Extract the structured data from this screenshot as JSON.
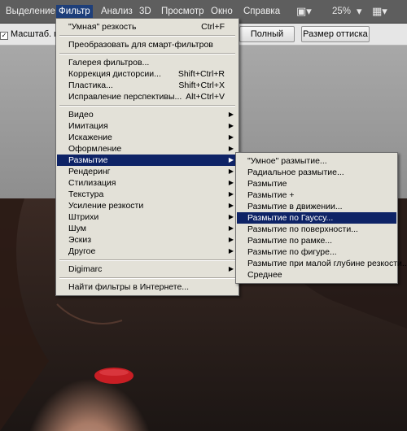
{
  "menubar": {
    "items": [
      "Выделение",
      "Фильтр",
      "Анализ",
      "3D",
      "Просмотр",
      "Окно",
      "Справка"
    ],
    "active": "Фильтр",
    "zoom": "25%"
  },
  "options_bar": {
    "checkbox_label": "Масштаб. пере",
    "buttons": [
      "Полный экран",
      "Размер оттиска"
    ]
  },
  "filter_menu": {
    "items": [
      {
        "label": "\"Умная\" резкость",
        "shortcut": "Ctrl+F"
      },
      {
        "label": "Преобразовать для смарт-фильтров"
      },
      {
        "label": "Галерея фильтров..."
      },
      {
        "label": "Коррекция дисторсии...",
        "shortcut": "Shift+Ctrl+R"
      },
      {
        "label": "Пластика...",
        "shortcut": "Shift+Ctrl+X"
      },
      {
        "label": "Исправление перспективы...",
        "shortcut": "Alt+Ctrl+V"
      },
      {
        "label": "Видео",
        "submenu": true
      },
      {
        "label": "Имитация",
        "submenu": true
      },
      {
        "label": "Искажение",
        "submenu": true
      },
      {
        "label": "Оформление",
        "submenu": true
      },
      {
        "label": "Размытие",
        "submenu": true,
        "highlighted": true
      },
      {
        "label": "Рендеринг",
        "submenu": true
      },
      {
        "label": "Стилизация",
        "submenu": true
      },
      {
        "label": "Текстура",
        "submenu": true
      },
      {
        "label": "Усиление резкости",
        "submenu": true
      },
      {
        "label": "Штрихи",
        "submenu": true
      },
      {
        "label": "Шум",
        "submenu": true
      },
      {
        "label": "Эскиз",
        "submenu": true
      },
      {
        "label": "Другое",
        "submenu": true
      },
      {
        "label": "Digimarc",
        "submenu": true
      },
      {
        "label": "Найти фильтры в Интернете..."
      }
    ]
  },
  "blur_submenu": {
    "items": [
      {
        "label": "\"Умное\" размытие..."
      },
      {
        "label": "Радиальное размытие..."
      },
      {
        "label": "Размытие"
      },
      {
        "label": "Размытие +"
      },
      {
        "label": "Размытие в движении..."
      },
      {
        "label": "Размытие по Гауссу...",
        "highlighted": true
      },
      {
        "label": "Размытие по поверхности..."
      },
      {
        "label": "Размытие по рамке..."
      },
      {
        "label": "Размытие по фигуре..."
      },
      {
        "label": "Размытие при малой глубине резкости..."
      },
      {
        "label": "Среднее"
      }
    ]
  },
  "colors": {
    "menu_bg": "#e3e1d8",
    "highlight": "#0e2366",
    "menubar_bg": "#5e5e5e"
  }
}
